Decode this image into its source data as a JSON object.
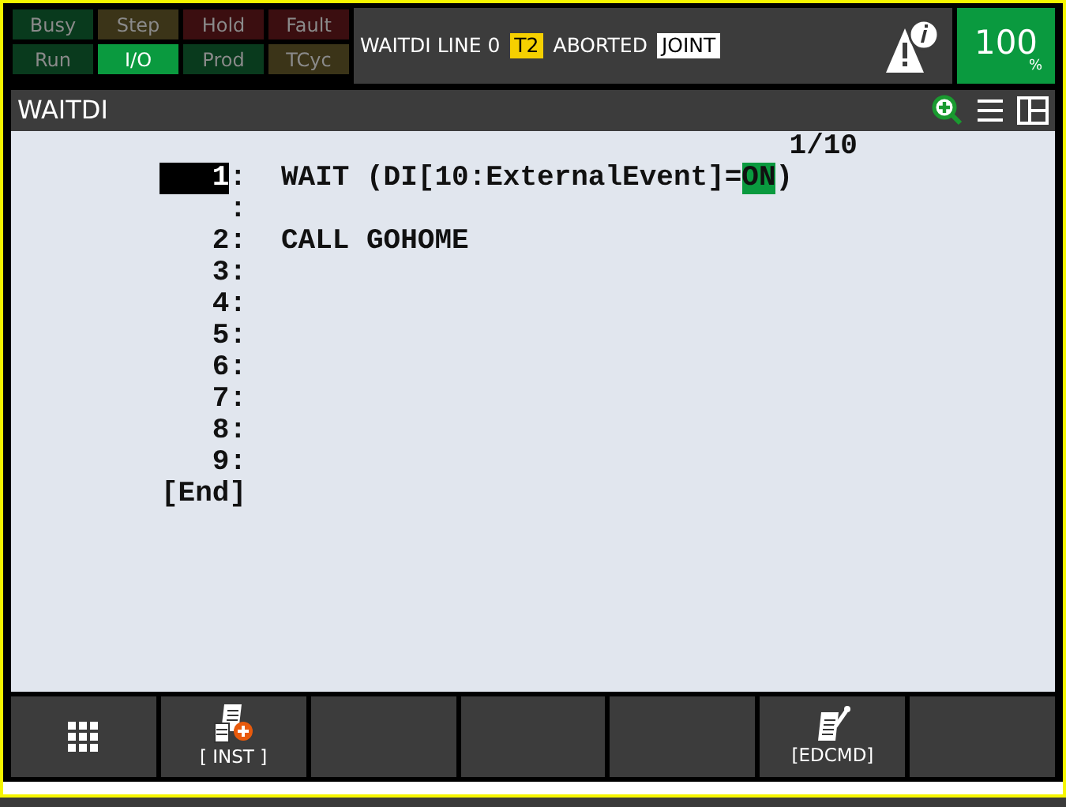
{
  "status_lights": [
    {
      "label": "Busy",
      "kind": "green",
      "on": false
    },
    {
      "label": "Step",
      "kind": "amber",
      "on": false
    },
    {
      "label": "Hold",
      "kind": "red",
      "on": false
    },
    {
      "label": "Fault",
      "kind": "red",
      "on": false
    },
    {
      "label": "Run",
      "kind": "green",
      "on": false
    },
    {
      "label": "I/O",
      "kind": "green",
      "on": true
    },
    {
      "label": "Prod",
      "kind": "green",
      "on": false
    },
    {
      "label": "TCyc",
      "kind": "amber",
      "on": false
    }
  ],
  "status_line": {
    "program": "WAITDI LINE 0",
    "mode": "T2",
    "state": "ABORTED",
    "coord": "JOINT"
  },
  "override": {
    "value": "100",
    "unit": "%"
  },
  "title": "WAITDI",
  "editor": {
    "position": "1/10",
    "lines": [
      {
        "number": "1",
        "suffix": ":",
        "selected": true,
        "segments": [
          {
            "text": "WAIT (DI[10:ExternalEvent]=",
            "highlighted": false
          },
          {
            "text": "ON",
            "highlighted": true
          },
          {
            "text": ")",
            "highlighted": false
          }
        ]
      },
      {
        "suffix": ":",
        "selected": false
      },
      {
        "number": "2",
        "suffix": ":",
        "selected": false,
        "segments": [
          {
            "text": "CALL GOHOME",
            "highlighted": false
          }
        ]
      },
      {
        "number": "3",
        "suffix": ":",
        "selected": false
      },
      {
        "number": "4",
        "suffix": ":",
        "selected": false
      },
      {
        "number": "5",
        "suffix": ":",
        "selected": false
      },
      {
        "number": "6",
        "suffix": ":",
        "selected": false
      },
      {
        "number": "7",
        "suffix": ":",
        "selected": false
      },
      {
        "number": "8",
        "suffix": ":",
        "selected": false
      },
      {
        "number": "9",
        "suffix": ":",
        "selected": false
      },
      {
        "number": "[End]",
        "selected": false
      }
    ]
  },
  "function_keys": [
    {
      "kind": "grid"
    },
    {
      "kind": "inst",
      "label": "[ INST ]"
    },
    {
      "kind": "empty"
    },
    {
      "kind": "empty"
    },
    {
      "kind": "empty"
    },
    {
      "kind": "edcmd",
      "label": "[EDCMD]"
    },
    {
      "kind": "empty"
    }
  ]
}
